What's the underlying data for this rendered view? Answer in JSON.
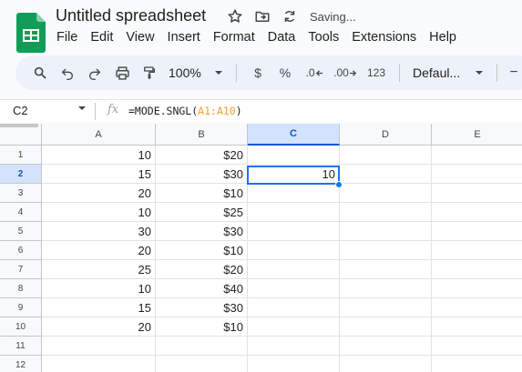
{
  "app": {
    "title": "Untitled spreadsheet",
    "status": "Saving...",
    "accent": "#0f9d58"
  },
  "menu": [
    "File",
    "Edit",
    "View",
    "Insert",
    "Format",
    "Data",
    "Tools",
    "Extensions",
    "Help"
  ],
  "toolbar": {
    "zoom": "100%",
    "currency": "$",
    "percent": "%",
    "decrease_decimals": ".0",
    "increase_decimals": ".00",
    "number_format": "123",
    "font": "Defaul...",
    "minus": "−"
  },
  "formula_bar": {
    "cell_ref": "C2",
    "fx": "fx",
    "formula_prefix": "=MODE.SNGL(",
    "formula_range": "A1:A10",
    "formula_suffix": ")"
  },
  "columns": [
    "A",
    "B",
    "C",
    "D",
    "E"
  ],
  "rows": [
    "1",
    "2",
    "3",
    "4",
    "5",
    "6",
    "7",
    "8",
    "9",
    "10",
    "11",
    "12"
  ],
  "cells": {
    "A": [
      "10",
      "15",
      "20",
      "10",
      "30",
      "20",
      "25",
      "10",
      "15",
      "20",
      "",
      ""
    ],
    "B": [
      "$20",
      "$30",
      "$10",
      "$25",
      "$30",
      "$10",
      "$20",
      "$40",
      "$30",
      "$10",
      "",
      ""
    ],
    "C": [
      "",
      "10",
      "",
      "",
      "",
      "",
      "",
      "",
      "",
      "",
      "",
      ""
    ]
  },
  "selected": {
    "column": "C",
    "row": "2"
  }
}
